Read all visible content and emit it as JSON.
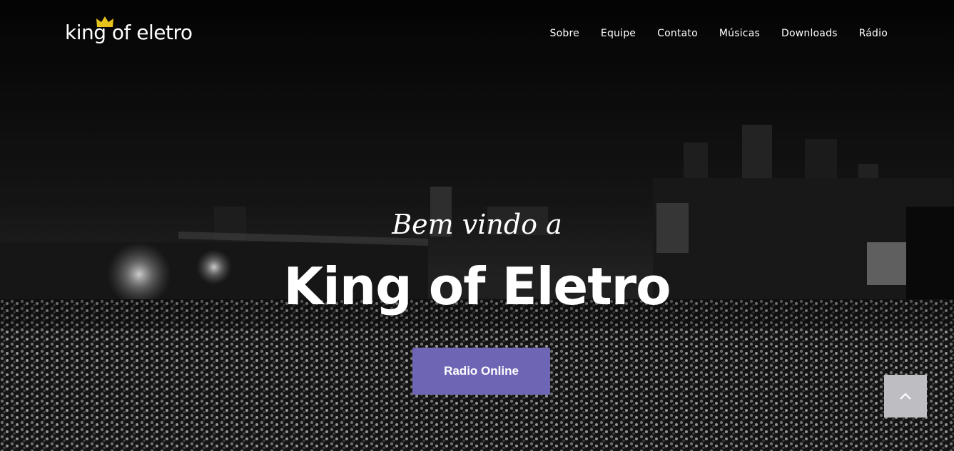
{
  "brand": {
    "name": "king of eletro",
    "crown_color": "#e6c31c"
  },
  "nav": {
    "items": [
      "Sobre",
      "Equipe",
      "Contato",
      "Músicas",
      "Downloads",
      "Rádio"
    ]
  },
  "hero": {
    "subtitle": "Bem vindo a",
    "title": "King of Eletro",
    "cta_label": "Radio Online",
    "cta_color": "#6e66b4"
  },
  "scroll_top": {
    "icon": "chevron-up-icon"
  }
}
